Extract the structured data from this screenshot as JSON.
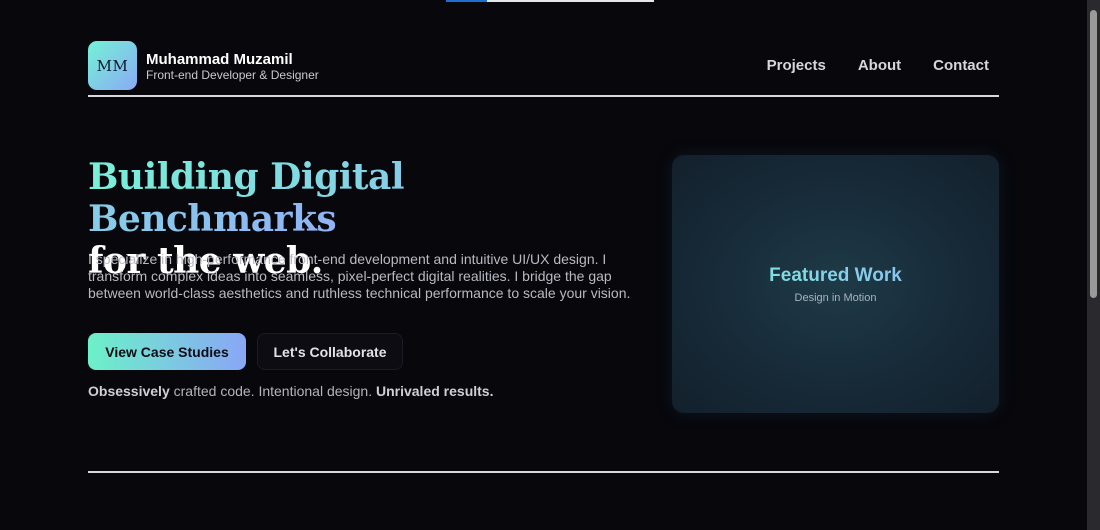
{
  "brand": {
    "logo_text": "MM",
    "name": "Muhammad Muzamil",
    "subtitle": "Front-end Developer & Designer"
  },
  "nav": {
    "items": [
      {
        "label": "Projects"
      },
      {
        "label": "About"
      },
      {
        "label": "Contact"
      }
    ]
  },
  "hero": {
    "title_gradient": "Building Digital Benchmarks",
    "title_plain": "for the web.",
    "description": "I specialize in high-performance front-end development and intuitive UI/UX design. I transform complex ideas into seamless, pixel-perfect digital realities. I bridge the gap between world-class aesthetics and ruthless technical performance to scale your vision.",
    "primary_button": "View Case Studies",
    "secondary_button": "Let's Collaborate",
    "tagline": {
      "bold_1": "Obsessively",
      "text_1": " crafted code. Intentional design. ",
      "bold_2": "Unrivaled results."
    }
  },
  "feature": {
    "title": "Featured Work",
    "subtitle": "Design in Motion"
  },
  "colors": {
    "background": "#07070c",
    "accent_start": "#79f0d8",
    "accent_end": "#90b3f5"
  }
}
